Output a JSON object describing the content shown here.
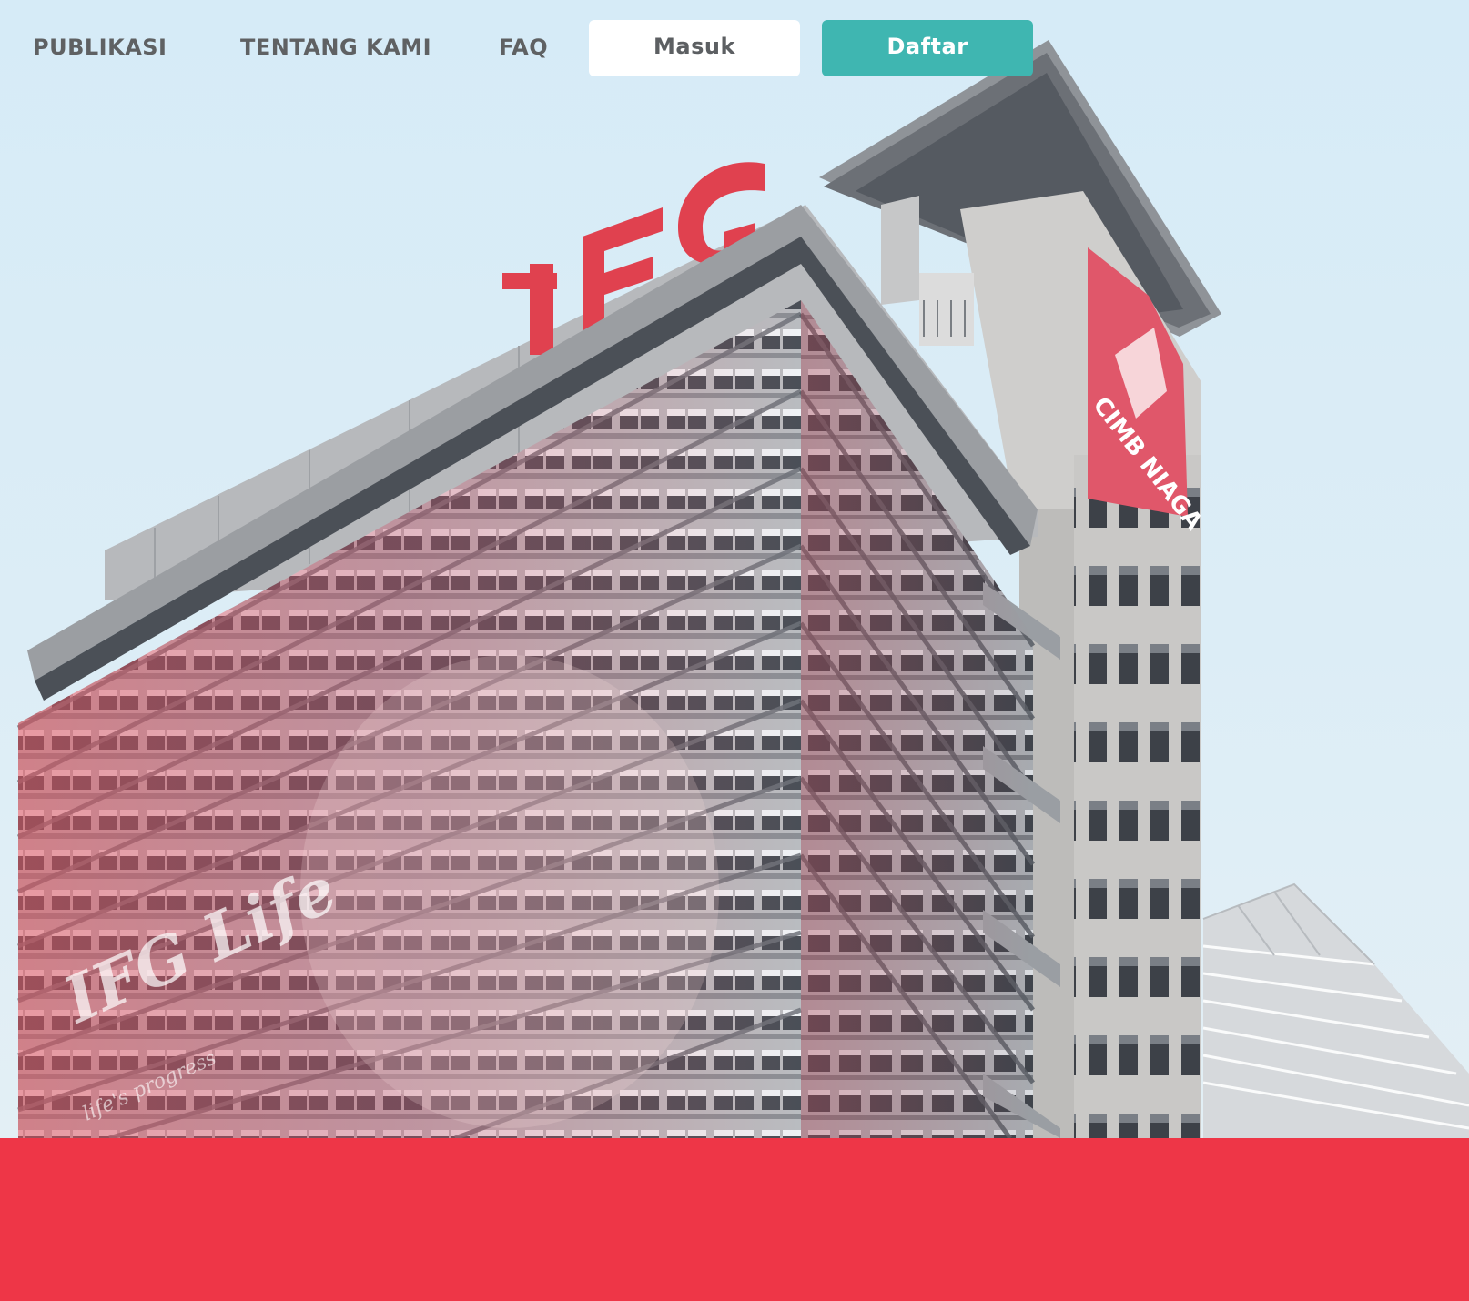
{
  "nav": {
    "links": [
      {
        "label": "PUBLIKASI"
      },
      {
        "label": "TENTANG KAMI"
      },
      {
        "label": "FAQ"
      }
    ],
    "login_label": "Masuk",
    "register_label": "Daftar"
  },
  "colors": {
    "nav_text": "#5f6163",
    "login_bg": "#ffffff",
    "register_bg": "#3fb6b1",
    "footer_band": "#ee3647",
    "sky": "#d6ebf7"
  },
  "hero": {
    "image": "office-tower-photo",
    "rooftop_sign": "IFG",
    "side_sign": "CIMB NIAGA",
    "facade_banner": "IFG Life"
  }
}
